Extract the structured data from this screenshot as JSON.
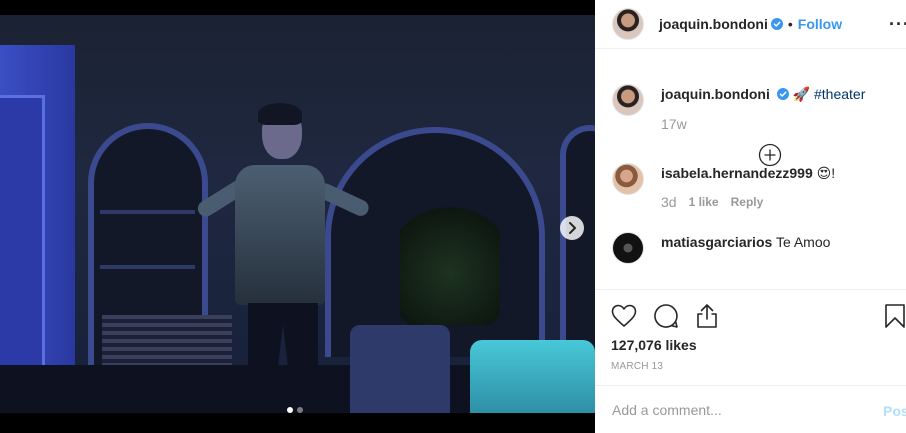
{
  "post": {
    "author": "joaquin.bondoni",
    "follow_label": "Follow",
    "separator": "•",
    "more_label": "···"
  },
  "caption": {
    "username": "joaquin.bondoni",
    "emoji": "🚀",
    "hashtag": "#theater",
    "time": "17w"
  },
  "comments": [
    {
      "username": "isabela.hernandezz999",
      "text": "😍!",
      "time": "3d",
      "likes": "1 like",
      "reply_label": "Reply"
    },
    {
      "username": "matiasgarciarios",
      "text": "Te Amoo"
    }
  ],
  "stats": {
    "likes": "127,076 likes",
    "date": "MARCH 13"
  },
  "composer": {
    "placeholder": "Add a comment...",
    "post_label": "Post"
  },
  "carousel": {
    "total": 2,
    "active": 1
  },
  "colors": {
    "link_blue": "#3897f0",
    "hashtag": "#003569",
    "muted": "#999999",
    "post_disabled": "#b2dffc"
  },
  "icons": [
    "verified-badge-icon",
    "more-options-icon",
    "load-more-comments-icon",
    "like-heart-icon",
    "comment-icon",
    "share-icon",
    "save-bookmark-icon",
    "carousel-next-icon"
  ]
}
